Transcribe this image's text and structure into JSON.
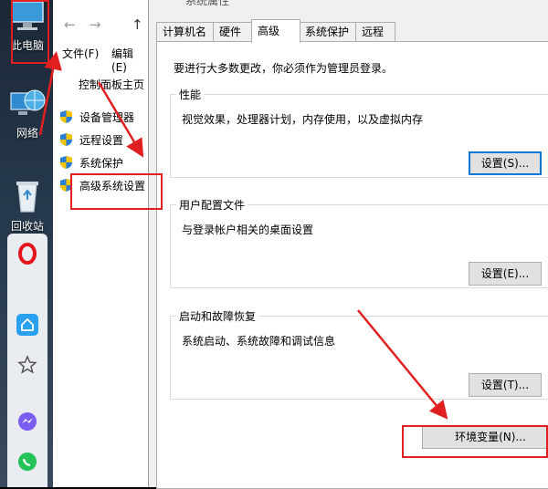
{
  "desktop": {
    "icons": [
      {
        "label": "此电脑"
      },
      {
        "label": "网络"
      },
      {
        "label": "回收站"
      }
    ]
  },
  "appbar": {
    "apps": [
      "opera-icon",
      "home-icon",
      "star-icon",
      "messenger-icon",
      "whatsapp-icon"
    ]
  },
  "explorer": {
    "menu": [
      "文件(F)",
      "编辑(E)"
    ],
    "control_panel_home": "控制面板主页",
    "links": [
      "设备管理器",
      "远程设置",
      "系统保护",
      "高级系统设置"
    ]
  },
  "dialog": {
    "title_partial": "系统属性",
    "tabs": [
      "计算机名",
      "硬件",
      "高级",
      "系统保护",
      "远程"
    ],
    "active_tab": "高级",
    "admin_note": "要进行大多数更改，你必须作为管理员登录。",
    "groups": [
      {
        "title": "性能",
        "desc": "视觉效果，处理器计划，内存使用，以及虚拟内存",
        "button": "设置(S)..."
      },
      {
        "title": "用户配置文件",
        "desc": "与登录帐户相关的桌面设置",
        "button": "设置(E)..."
      },
      {
        "title": "启动和故障恢复",
        "desc": "系统启动、系统故障和调试信息",
        "button": "设置(T)..."
      }
    ],
    "env_button": "环境变量(N)..."
  },
  "colors": {
    "annotation_red": "#e02020",
    "focus_blue": "#0078d7"
  }
}
